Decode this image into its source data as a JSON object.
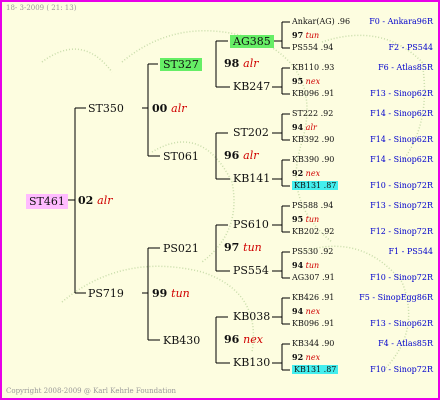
{
  "header": {
    "date_text": "18-  3-2009 ( 21: 13)"
  },
  "footer": {
    "copyright": "Copyright 2008-2009 @ Karl Kehrle Foundation"
  },
  "colors": {
    "border": "#e800e8",
    "background": "#fdfde0",
    "species": "#d00000",
    "origin": "#0000cc",
    "highlight_green": "#66ee66",
    "highlight_cyan": "#44eeee",
    "highlight_pink": "#ffbbff"
  },
  "root": {
    "id": "ST461",
    "gen": "02",
    "sp": "alr"
  },
  "g1": [
    {
      "id": "ST350",
      "gen": "00",
      "sp": "alr"
    },
    {
      "id": "PS719",
      "gen": "99",
      "sp": "tun"
    }
  ],
  "g2": [
    {
      "id": "ST327",
      "gen": "98",
      "sp": "alr"
    },
    {
      "id": "ST061",
      "gen": "96",
      "sp": "alr"
    },
    {
      "id": "PS021",
      "gen": "97",
      "sp": "tun"
    },
    {
      "id": "KB430",
      "gen": "96",
      "sp": "nex"
    }
  ],
  "g3": [
    "AG385",
    "KB247",
    "ST202",
    "KB141",
    "PS610",
    "PS554",
    "KB038",
    "KB130"
  ],
  "leaves": [
    {
      "sire": "Ankar(AG)",
      "sire_gen": ".96",
      "sire_origin": "F0 - Ankara96R",
      "gen": "97",
      "sp": "tun",
      "dam": "PS554",
      "dam_gen": ".94",
      "dam_origin": "F2 - PS544"
    },
    {
      "sire": "KB110",
      "sire_gen": ".93",
      "sire_origin": "F6 - Atlas85R",
      "gen": "95",
      "sp": "nex",
      "dam": "KB096",
      "dam_gen": ".91",
      "dam_origin": "F13 - Sinop62R"
    },
    {
      "sire": "ST222",
      "sire_gen": ".92",
      "sire_origin": "F14 - Sinop62R",
      "gen": "94",
      "sp": "alr",
      "dam": "KB392",
      "dam_gen": ".90",
      "dam_origin": "F14 - Sinop62R"
    },
    {
      "sire": "KB390",
      "sire_gen": ".90",
      "sire_origin": "F14 - Sinop62R",
      "gen": "92",
      "sp": "nex",
      "dam": "KB131",
      "dam_gen": ".87",
      "dam_origin": "F10 - Sinop72R"
    },
    {
      "sire": "PS588",
      "sire_gen": ".94",
      "sire_origin": "F13 - Sinop72R",
      "gen": "95",
      "sp": "tun",
      "dam": "KB202",
      "dam_gen": ".92",
      "dam_origin": "F12 - Sinop72R"
    },
    {
      "sire": "PS530",
      "sire_gen": ".92",
      "sire_origin": "F1 - PS544",
      "gen": "94",
      "sp": "tun",
      "dam": "AG307",
      "dam_gen": ".91",
      "dam_origin": "F10 - Sinop72R"
    },
    {
      "sire": "KB426",
      "sire_gen": ".91",
      "sire_origin": "F5 - SinopEgg86R",
      "gen": "94",
      "sp": "nex",
      "dam": "KB096",
      "dam_gen": ".91",
      "dam_origin": "F13 - Sinop62R"
    },
    {
      "sire": "KB344",
      "sire_gen": ".90",
      "sire_origin": "F4 - Atlas85R",
      "gen": "92",
      "sp": "nex",
      "dam": "KB131",
      "dam_gen": ".87",
      "dam_origin": "F10 - Sinop72R"
    }
  ]
}
